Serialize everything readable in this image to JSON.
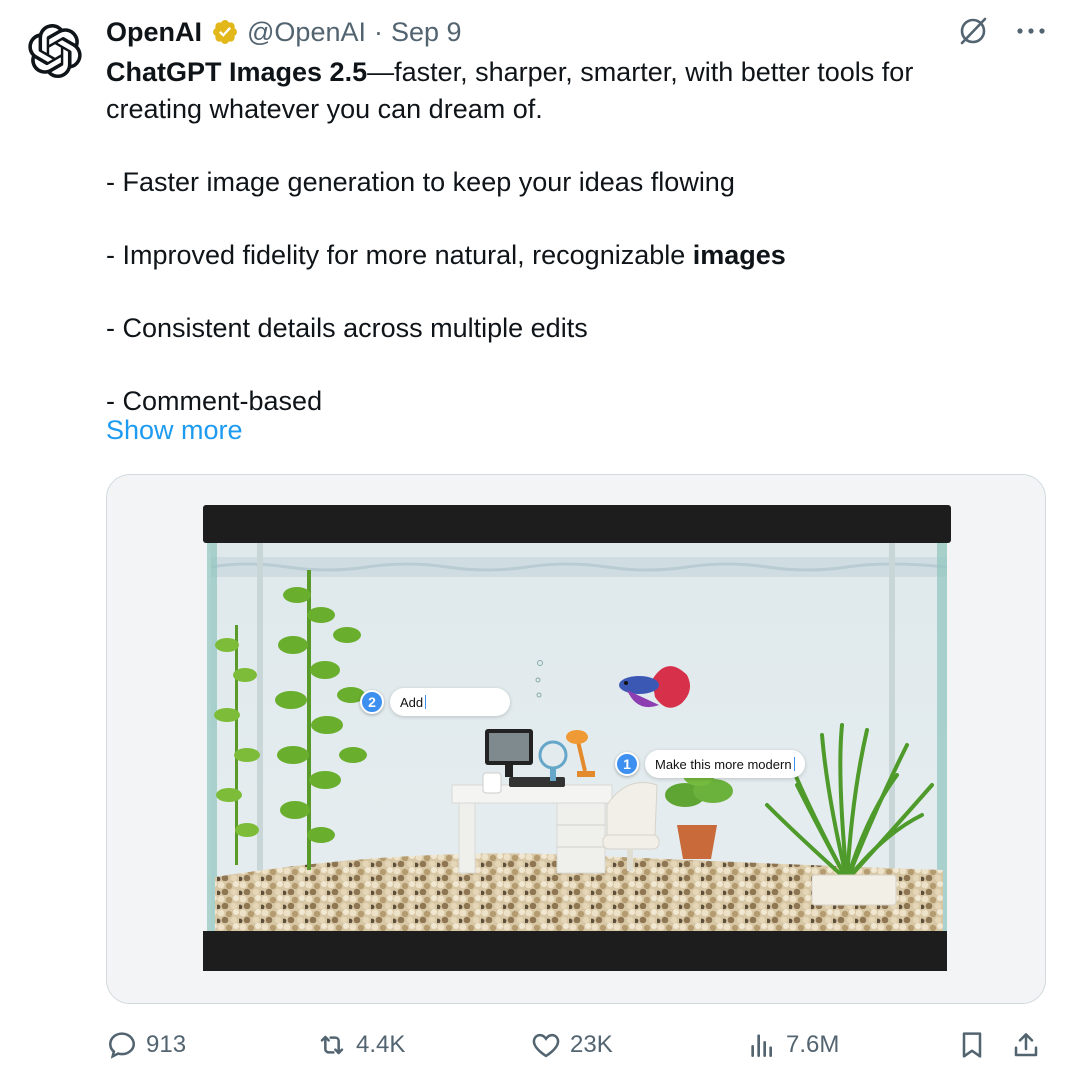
{
  "author": {
    "name": "OpenAI",
    "handle": "@OpenAI",
    "separator": "·",
    "date": "Sep 9"
  },
  "icons": {
    "avatar": "openai-logo-icon",
    "verified": "verified-badge-icon",
    "grok": "grok-icon",
    "more": "more-icon"
  },
  "tweet": {
    "title_bold": "ChatGPT Images 2.5",
    "title_rest": "—faster, sharper, smarter, with better tools for creating whatever you can dream of.",
    "bullet1": "- Faster image generation to keep your ideas flowing",
    "bullet2_start": "- Improved fidelity for more natural, recognizable ",
    "bullet2_bold": "images",
    "bullet3": "- Consistent details across multiple edits",
    "bullet4": "- Comment-based",
    "show_more": "Show more"
  },
  "media": {
    "comment1": {
      "number": "1",
      "text": "Make this more modern"
    },
    "comment2": {
      "number": "2",
      "text": "Add"
    }
  },
  "stats": {
    "replies": "913",
    "reposts": "4.4K",
    "likes": "23K",
    "views": "7.6M"
  },
  "colors": {
    "accent": "#1d9bf0",
    "muted": "#536471",
    "verified_gold": "#e2b719",
    "comment_pin": "#3d8ff0"
  }
}
